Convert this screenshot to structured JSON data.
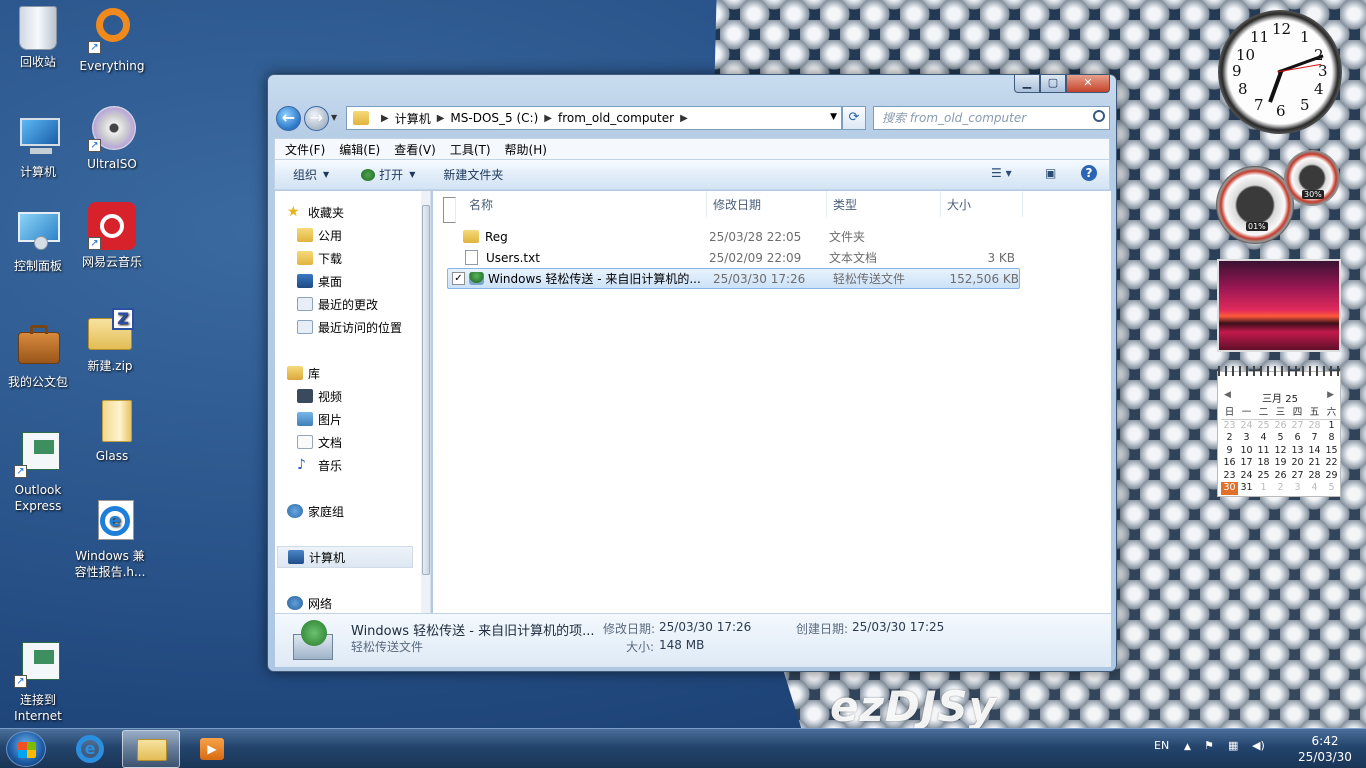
{
  "desktop": {
    "icons": [
      {
        "label": "回收站"
      },
      {
        "label": "Everything"
      },
      {
        "label": "计算机"
      },
      {
        "label": "UltraISO"
      },
      {
        "label": "控制面板"
      },
      {
        "label": "网易云音乐"
      },
      {
        "label": "我的公文包"
      },
      {
        "label": "新建.zip"
      },
      {
        "label": "Glass"
      },
      {
        "label": "Outlook Express"
      },
      {
        "label": "Windows 兼容性报告.h..."
      },
      {
        "label": "连接到 Internet"
      }
    ],
    "watermark": "ezDJSy www.bzdjsm.com"
  },
  "window": {
    "address": {
      "crumbs": [
        "计算机",
        "MS-DOS_5 (C:)",
        "from_old_computer"
      ]
    },
    "search_placeholder": "搜索 from_old_computer",
    "menu": [
      "文件(F)",
      "编辑(E)",
      "查看(V)",
      "工具(T)",
      "帮助(H)"
    ],
    "toolbar": {
      "organize": "组织",
      "open": "打开",
      "new_folder": "新建文件夹"
    },
    "nav": {
      "favorites": "收藏夹",
      "public": "公用",
      "downloads": "下载",
      "desktop": "桌面",
      "recent_changes": "最近的更改",
      "recent_places": "最近访问的位置",
      "library": "库",
      "videos": "视频",
      "pictures": "图片",
      "documents": "文档",
      "music": "音乐",
      "homegroup": "家庭组",
      "computer": "计算机",
      "network": "网络"
    },
    "columns": {
      "name": "名称",
      "modified": "修改日期",
      "type": "类型",
      "size": "大小"
    },
    "files": [
      {
        "name": "Reg",
        "modified": "25/03/28 22:05",
        "type": "文件夹",
        "size": ""
      },
      {
        "name": "Users.txt",
        "modified": "25/02/09 22:09",
        "type": "文本文档",
        "size": "3 KB"
      },
      {
        "name": "Windows 轻松传送 - 来自旧计算机的...",
        "modified": "25/03/30 17:26",
        "type": "轻松传送文件",
        "size": "152,506 KB"
      }
    ],
    "details": {
      "name": "Windows 轻松传送 - 来自旧计算机的项...",
      "type": "轻松传送文件",
      "modified_label": "修改日期:",
      "modified": "25/03/30 17:26",
      "created_label": "创建日期:",
      "created": "25/03/30 17:25",
      "size_label": "大小:",
      "size": "148 MB"
    }
  },
  "gadgets": {
    "clock_numbers": [
      "12",
      "1",
      "2",
      "3",
      "4",
      "5",
      "6",
      "7",
      "8",
      "9",
      "10",
      "11"
    ],
    "cpu": "01%",
    "memory": "30%",
    "calendar": {
      "title": "三月 25",
      "weekdays": [
        "日",
        "一",
        "二",
        "三",
        "四",
        "五",
        "六"
      ],
      "days": [
        "23",
        "24",
        "25",
        "26",
        "27",
        "28",
        "1",
        "2",
        "3",
        "4",
        "5",
        "6",
        "7",
        "8",
        "9",
        "10",
        "11",
        "12",
        "13",
        "14",
        "15",
        "16",
        "17",
        "18",
        "19",
        "20",
        "21",
        "22",
        "23",
        "24",
        "25",
        "26",
        "27",
        "28",
        "29",
        "30",
        "31",
        "1",
        "2",
        "3",
        "4",
        "5"
      ]
    }
  },
  "taskbar": {
    "lang": "EN",
    "time": "6:42",
    "date": "25/03/30"
  }
}
